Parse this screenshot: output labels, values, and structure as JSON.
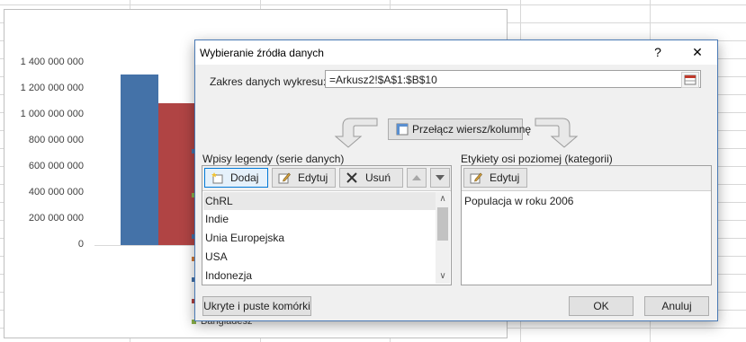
{
  "chart": {
    "y_ticks": [
      "1 400 000 000",
      "1 200 000 000",
      "1 000 000 000",
      "800 000 000",
      "600 000 000",
      "400 000 000",
      "200 000 000",
      "0"
    ],
    "bar_colors": [
      "#4472a8",
      "#b04444"
    ],
    "bar_values": [
      1311000000,
      1090000000
    ],
    "y_max": 1400000000,
    "legend_visible_label": "Bangladesz",
    "legend_marker_colors": [
      "#4472a8",
      "#b04444",
      "#8ab04a",
      "#4472a8",
      "#d07a3a",
      "#4472a8",
      "#b04444",
      "#8ab04a"
    ]
  },
  "dialog": {
    "title": "Wybieranie źródła danych",
    "help": "?",
    "close": "✕",
    "range_label": "Zakres danych wykresu:",
    "range_value": "=Arkusz2!$A$1:$B$10",
    "switch_label": "Przełącz wiersz/kolumnę",
    "legend_panel_label": "Wpisy legendy (serie danych)",
    "axis_panel_label": "Etykiety osi poziomej (kategorii)",
    "add_label": "Dodaj",
    "edit_label": "Edytuj",
    "remove_label": "Usuń",
    "axis_edit_label": "Edytuj",
    "series": [
      "ChRL",
      "Indie",
      "Unia Europejska",
      "USA",
      "Indonezja"
    ],
    "categories": [
      "Populacja w roku 2006"
    ],
    "hidden_cells_label": "Ukryte i puste komórki",
    "ok_label": "OK",
    "cancel_label": "Anuluj"
  }
}
